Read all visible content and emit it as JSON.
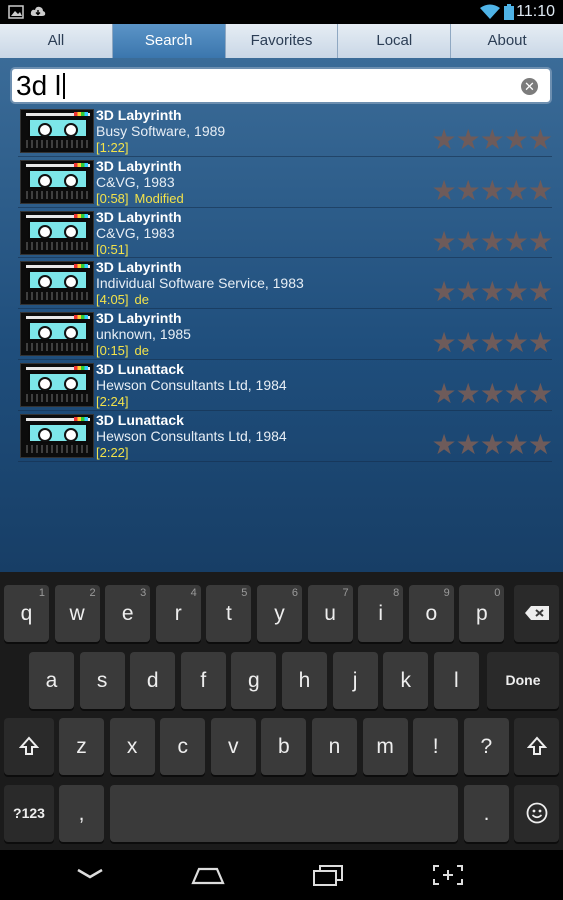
{
  "status": {
    "time": "11:10"
  },
  "tabs": [
    {
      "label": "All"
    },
    {
      "label": "Search"
    },
    {
      "label": "Favorites"
    },
    {
      "label": "Local"
    },
    {
      "label": "About"
    }
  ],
  "search": {
    "query": "3d l"
  },
  "results": [
    {
      "title": "3D Labyrinth",
      "publisher": "Busy Software, 1989",
      "duration": "[1:22]",
      "extra": ""
    },
    {
      "title": "3D Labyrinth",
      "publisher": "C&VG, 1983",
      "duration": "[0:58]",
      "extra": "Modified"
    },
    {
      "title": "3D Labyrinth",
      "publisher": "C&VG, 1983",
      "duration": "[0:51]",
      "extra": ""
    },
    {
      "title": "3D Labyrinth",
      "publisher": "Individual Software Service, 1983",
      "duration": "[4:05]",
      "extra": "de"
    },
    {
      "title": "3D Labyrinth",
      "publisher": "unknown, 1985",
      "duration": "[0:15]",
      "extra": "de"
    },
    {
      "title": "3D Lunattack",
      "publisher": "Hewson Consultants Ltd, 1984",
      "duration": "[2:24]",
      "extra": ""
    },
    {
      "title": "3D Lunattack",
      "publisher": "Hewson Consultants Ltd, 1984",
      "duration": "[2:22]",
      "extra": ""
    }
  ],
  "rating": {
    "stars": "★★★★★",
    "filled": 0,
    "max": 5
  },
  "keyboard": {
    "row1": [
      "q",
      "w",
      "e",
      "r",
      "t",
      "y",
      "u",
      "i",
      "o",
      "p"
    ],
    "row1_nums": [
      "1",
      "2",
      "3",
      "4",
      "5",
      "6",
      "7",
      "8",
      "9",
      "0"
    ],
    "row2": [
      "a",
      "s",
      "d",
      "f",
      "g",
      "h",
      "j",
      "k",
      "l"
    ],
    "row3": [
      "z",
      "x",
      "c",
      "v",
      "b",
      "n",
      "m",
      "!",
      "?"
    ],
    "done": "Done",
    "sym": "?123",
    "comma": ",",
    "period": "."
  },
  "colors": {
    "accent": "#3b76ad",
    "duration": "#f3e24a",
    "star": "#6e5b5a"
  }
}
